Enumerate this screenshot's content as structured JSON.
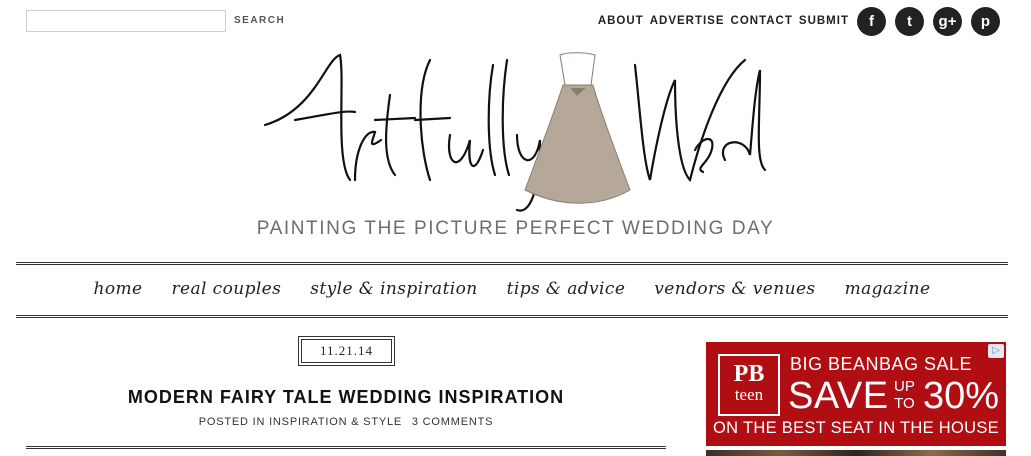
{
  "search": {
    "placeholder": "",
    "button_label": "SEARCH"
  },
  "top_nav": [
    "ABOUT",
    "ADVERTISE",
    "CONTACT",
    "SUBMIT"
  ],
  "social": [
    {
      "name": "facebook",
      "glyph": "f"
    },
    {
      "name": "twitter",
      "glyph": "t"
    },
    {
      "name": "google-plus",
      "glyph": "g+"
    },
    {
      "name": "pinterest",
      "glyph": "p"
    }
  ],
  "brand": {
    "name": "Artfully Wed",
    "tagline": "PAINTING THE PICTURE PERFECT WEDDING DAY",
    "accent": "#b5a898"
  },
  "main_nav": [
    "home",
    "real couples",
    "style & inspiration",
    "tips & advice",
    "vendors & venues",
    "magazine"
  ],
  "post": {
    "date": "11.21.14",
    "title": "MODERN FAIRY TALE WEDDING INSPIRATION",
    "posted_in_label": "POSTED IN INSPIRATION & STYLE",
    "comments": "3 COMMENTS"
  },
  "ad": {
    "brand_top": "PB",
    "brand_bottom": "teen",
    "headline": "BIG BEANBAG SALE",
    "save": "SAVE",
    "up": "UP",
    "to": "TO",
    "percent": "30%",
    "footer": "ON THE BEST SEAT IN THE HOUSE",
    "color": "#b00e13"
  }
}
